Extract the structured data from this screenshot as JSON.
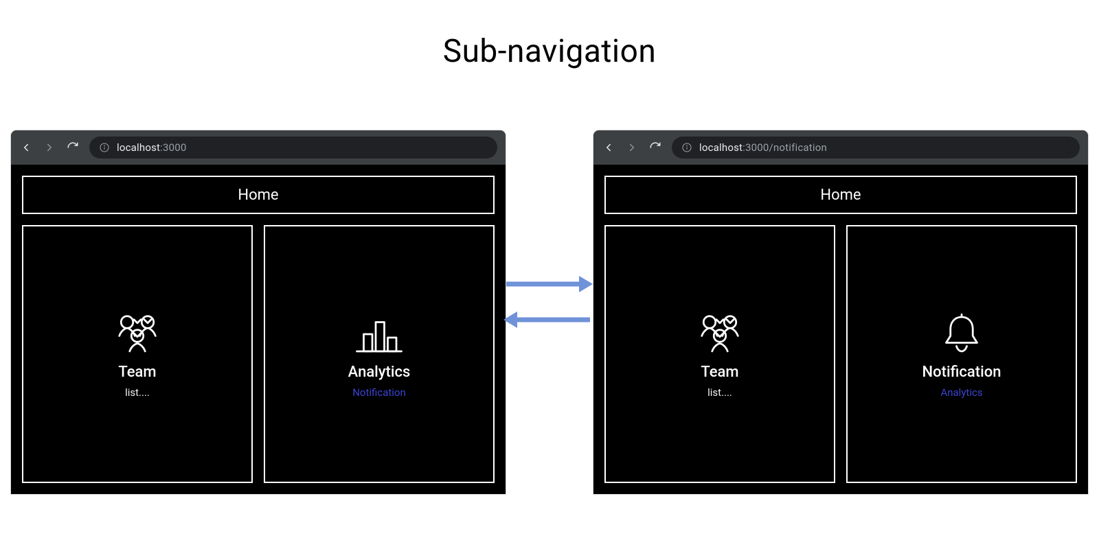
{
  "title": "Sub-navigation",
  "browsers": {
    "left": {
      "url_host": "localhost",
      "url_path": ":3000",
      "home_label": "Home",
      "card1": {
        "title": "Team",
        "sub": "list...."
      },
      "card2": {
        "title": "Analytics",
        "link": "Notification"
      }
    },
    "right": {
      "url_host": "localhost",
      "url_path": ":3000/notification",
      "home_label": "Home",
      "card1": {
        "title": "Team",
        "sub": "list...."
      },
      "card2": {
        "title": "Notification",
        "link": "Analytics"
      }
    }
  }
}
